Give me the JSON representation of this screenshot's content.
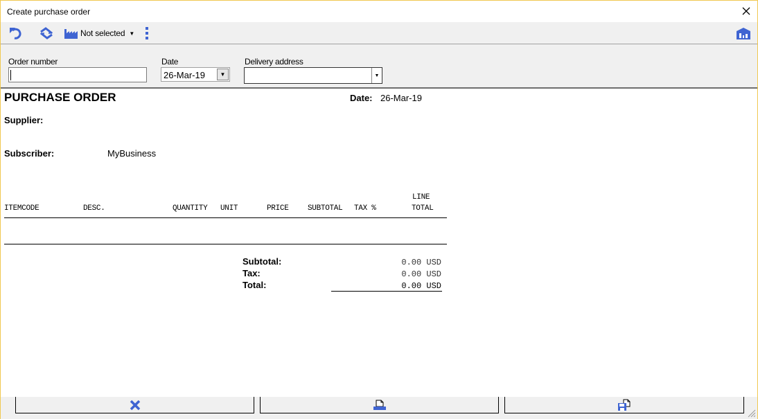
{
  "window": {
    "title": "Create purchase order"
  },
  "toolbar": {
    "undo_icon": "undo-icon",
    "sync_icon": "sync-icon",
    "supplier_icon": "factory-icon",
    "supplier_label": "Not selected",
    "more_icon": "more-vertical-icon",
    "warehouse_icon": "warehouse-icon"
  },
  "form": {
    "order_number_label": "Order number",
    "order_number_value": "",
    "date_label": "Date",
    "date_value": "26-Mar-19",
    "delivery_address_label": "Delivery address",
    "delivery_address_value": ""
  },
  "document": {
    "title": "PURCHASE ORDER",
    "date_label": "Date:",
    "date_value": "26-Mar-19",
    "supplier_label": "Supplier:",
    "supplier_value": "",
    "subscriber_label": "Subscriber:",
    "subscriber_value": "MyBusiness",
    "columns": [
      "ITEMCODE",
      "DESC.",
      "QUANTITY",
      "UNIT",
      "PRICE",
      "SUBTOTAL",
      "TAX %",
      "LINE",
      "TOTAL"
    ],
    "rows": [],
    "summary": {
      "subtotal_label": "Subtotal:",
      "subtotal_value": "0.00 USD",
      "tax_label": "Tax:",
      "tax_value": "0.00 USD",
      "total_label": "Total:",
      "total_value": "0.00 USD"
    }
  },
  "bottom_buttons": {
    "cancel_icon": "cancel-x-icon",
    "print_icon": "print-icon",
    "save_icon": "save-icon"
  },
  "colors": {
    "accent": "#3f64d2",
    "window_border": "#f0c850"
  }
}
